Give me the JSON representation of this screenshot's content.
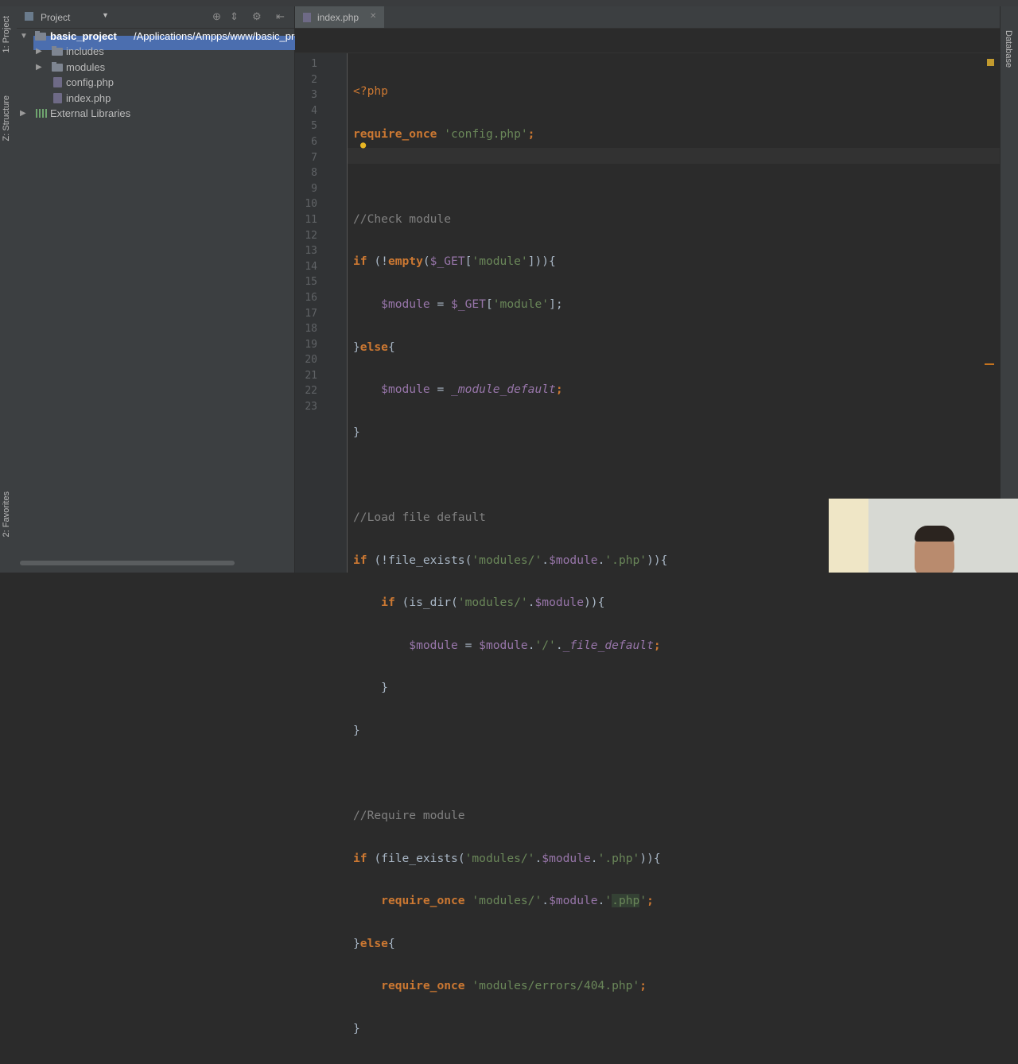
{
  "project_panel": {
    "title": "Project",
    "root": {
      "name": "basic_project",
      "path": "/Applications/Ampps/www/basic_project"
    },
    "items": [
      {
        "label": "includes",
        "type": "folder"
      },
      {
        "label": "modules",
        "type": "folder"
      },
      {
        "label": "config.php",
        "type": "file"
      },
      {
        "label": "index.php",
        "type": "file"
      }
    ],
    "external": "External Libraries"
  },
  "left_strip": {
    "project_tab": "1: Project",
    "structure_tab": "Z: Structure",
    "favorites_tab": "2: Favorites"
  },
  "right_strip": {
    "database_tab": "Database"
  },
  "editor": {
    "active_tab": "index.php",
    "line_numbers": [
      "1",
      "2",
      "3",
      "4",
      "5",
      "6",
      "7",
      "8",
      "9",
      "10",
      "11",
      "12",
      "13",
      "14",
      "15",
      "16",
      "17",
      "18",
      "19",
      "20",
      "21",
      "22",
      "23"
    ],
    "code": {
      "l1": "<?php",
      "l2a": "require_once",
      "l2b": "'config.php'",
      "l2c": ";",
      "l4": "//Check module",
      "l5a": "if",
      "l5b": " (!",
      "l5c": "empty",
      "l5d": "(",
      "l5e": "$_GET",
      "l5f": "[",
      "l5g": "'module'",
      "l5h": "])){",
      "l6a": "    ",
      "l6b": "$module",
      "l6c": " = ",
      "l6d": "$_GET",
      "l6e": "[",
      "l6f": "'module'",
      "l6g": "];",
      "l7a": "}",
      "l7b": "else",
      "l7c": "{",
      "l8a": "    ",
      "l8b": "$module",
      "l8c": " = ",
      "l8d": "_module_default",
      "l8e": ";",
      "l9": "}",
      "l11": "//Load file default",
      "l12a": "if",
      "l12b": " (!",
      "l12c": "file_exists",
      "l12d": "(",
      "l12e": "'modules/'",
      "l12f": ".",
      "l12g": "$module",
      "l12h": ".",
      "l12i": "'.php'",
      "l12j": ")){",
      "l13a": "    ",
      "l13b": "if",
      "l13c": " (",
      "l13d": "is_dir",
      "l13e": "(",
      "l13f": "'modules/'",
      "l13g": ".",
      "l13h": "$module",
      "l13i": ")){",
      "l14a": "        ",
      "l14b": "$module",
      "l14c": " = ",
      "l14d": "$module",
      "l14e": ".",
      "l14f": "'/'",
      "l14g": ".",
      "l14h": "_file_default",
      "l14i": ";",
      "l15": "    }",
      "l16": "}",
      "l18": "//Require module",
      "l19a": "if",
      "l19b": " (",
      "l19c": "file_exists",
      "l19d": "(",
      "l19e": "'modules/'",
      "l19f": ".",
      "l19g": "$module",
      "l19h": ".",
      "l19i": "'.php'",
      "l19j": ")){",
      "l20a": "    ",
      "l20b": "require_once",
      "l20c": " ",
      "l20d": "'modules/'",
      "l20e": ".",
      "l20f": "$module",
      "l20g": ".",
      "l20h": "'",
      "l20i": ".php",
      "l20j": "'",
      "l20k": ";",
      "l21a": "}",
      "l21b": "else",
      "l21c": "{",
      "l22a": "    ",
      "l22b": "require_once",
      "l22c": " ",
      "l22d": "'modules/errors/404.php'",
      "l22e": ";",
      "l23": "}"
    }
  },
  "colors": {
    "keyword": "#cc7832",
    "string": "#6a8759",
    "variable": "#9876aa",
    "comment": "#808080",
    "selection": "#4b6eaf"
  },
  "icons": [
    "folder-icon",
    "php-file-icon",
    "gear-icon",
    "collapse-icon",
    "target-icon",
    "close-icon",
    "lightbulb-icon",
    "external-libraries-icon"
  ]
}
